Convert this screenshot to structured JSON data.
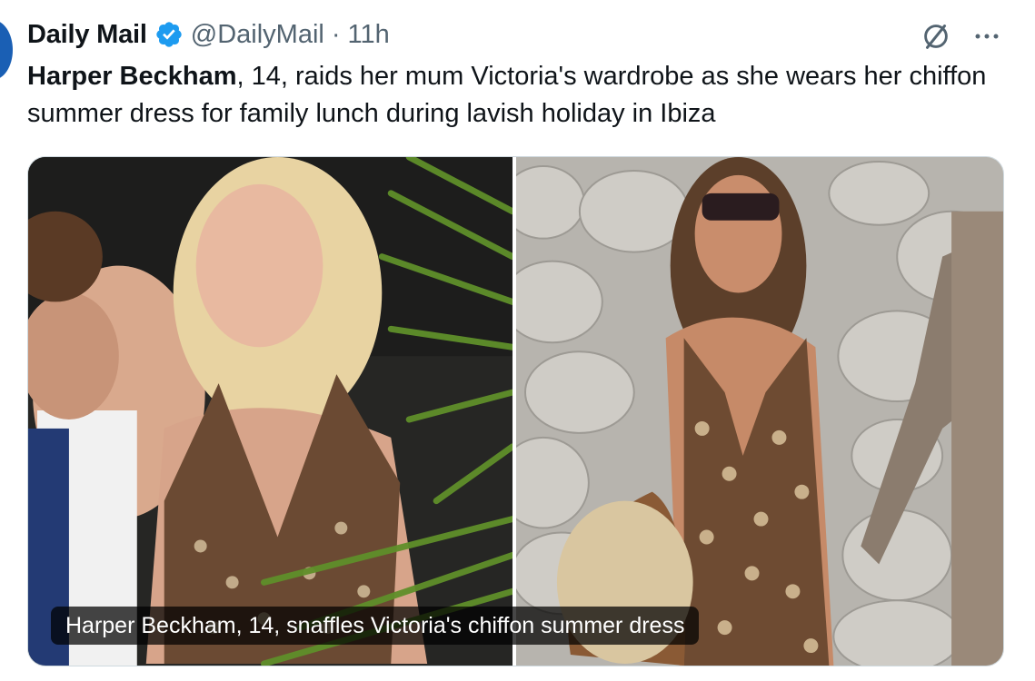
{
  "post": {
    "author": {
      "display_name": "Daily Mail",
      "handle": "@DailyMail",
      "separator": "·",
      "time": "11h",
      "verified_icon": "verified-badge-icon"
    },
    "text_bold": "Harper Beckham",
    "text_rest": ", 14, raids her mum Victoria's wardrobe as she wears her chiffon summer dress for family lunch during lavish holiday in Ibiza",
    "media": {
      "caption": "Harper Beckham, 14, snaffles Victoria's chiffon summer dress",
      "images": [
        "left-photo",
        "right-photo"
      ]
    },
    "actions": {
      "grok_icon": "grok-slash-circle-icon",
      "more_icon": "more-dots-icon"
    }
  },
  "colors": {
    "text": "#0f1419",
    "secondary": "#536471",
    "verified": "#1d9bf0",
    "border": "#cfd9de"
  }
}
